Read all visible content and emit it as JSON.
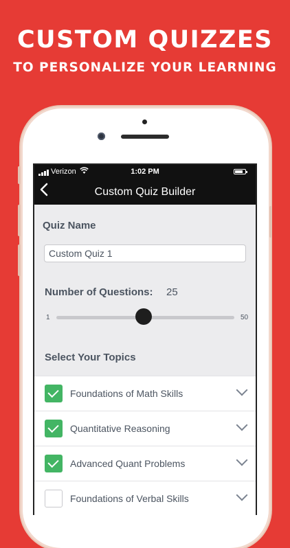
{
  "promo": {
    "headline": "CUSTOM QUIZZES",
    "subheadline": "TO PERSONALIZE YOUR LEARNING"
  },
  "status_bar": {
    "carrier": "Verizon",
    "time": "1:02 PM"
  },
  "nav": {
    "back_icon": "chevron-left-icon",
    "title": "Custom Quiz Builder"
  },
  "quiz_name": {
    "label": "Quiz Name",
    "value": "Custom Quiz 1"
  },
  "questions": {
    "label": "Number of Questions:",
    "value": "25",
    "min": "1",
    "max": "50",
    "slider_value": 25
  },
  "topics": {
    "label": "Select Your Topics",
    "items": [
      {
        "label": "Foundations of Math Skills",
        "checked": true
      },
      {
        "label": "Quantitative Reasoning",
        "checked": true
      },
      {
        "label": "Advanced Quant Problems",
        "checked": true
      },
      {
        "label": "Foundations of Verbal Skills",
        "checked": false
      }
    ]
  },
  "colors": {
    "background": "#e63b35",
    "check_green": "#43b564",
    "nav_bar": "#111111"
  }
}
